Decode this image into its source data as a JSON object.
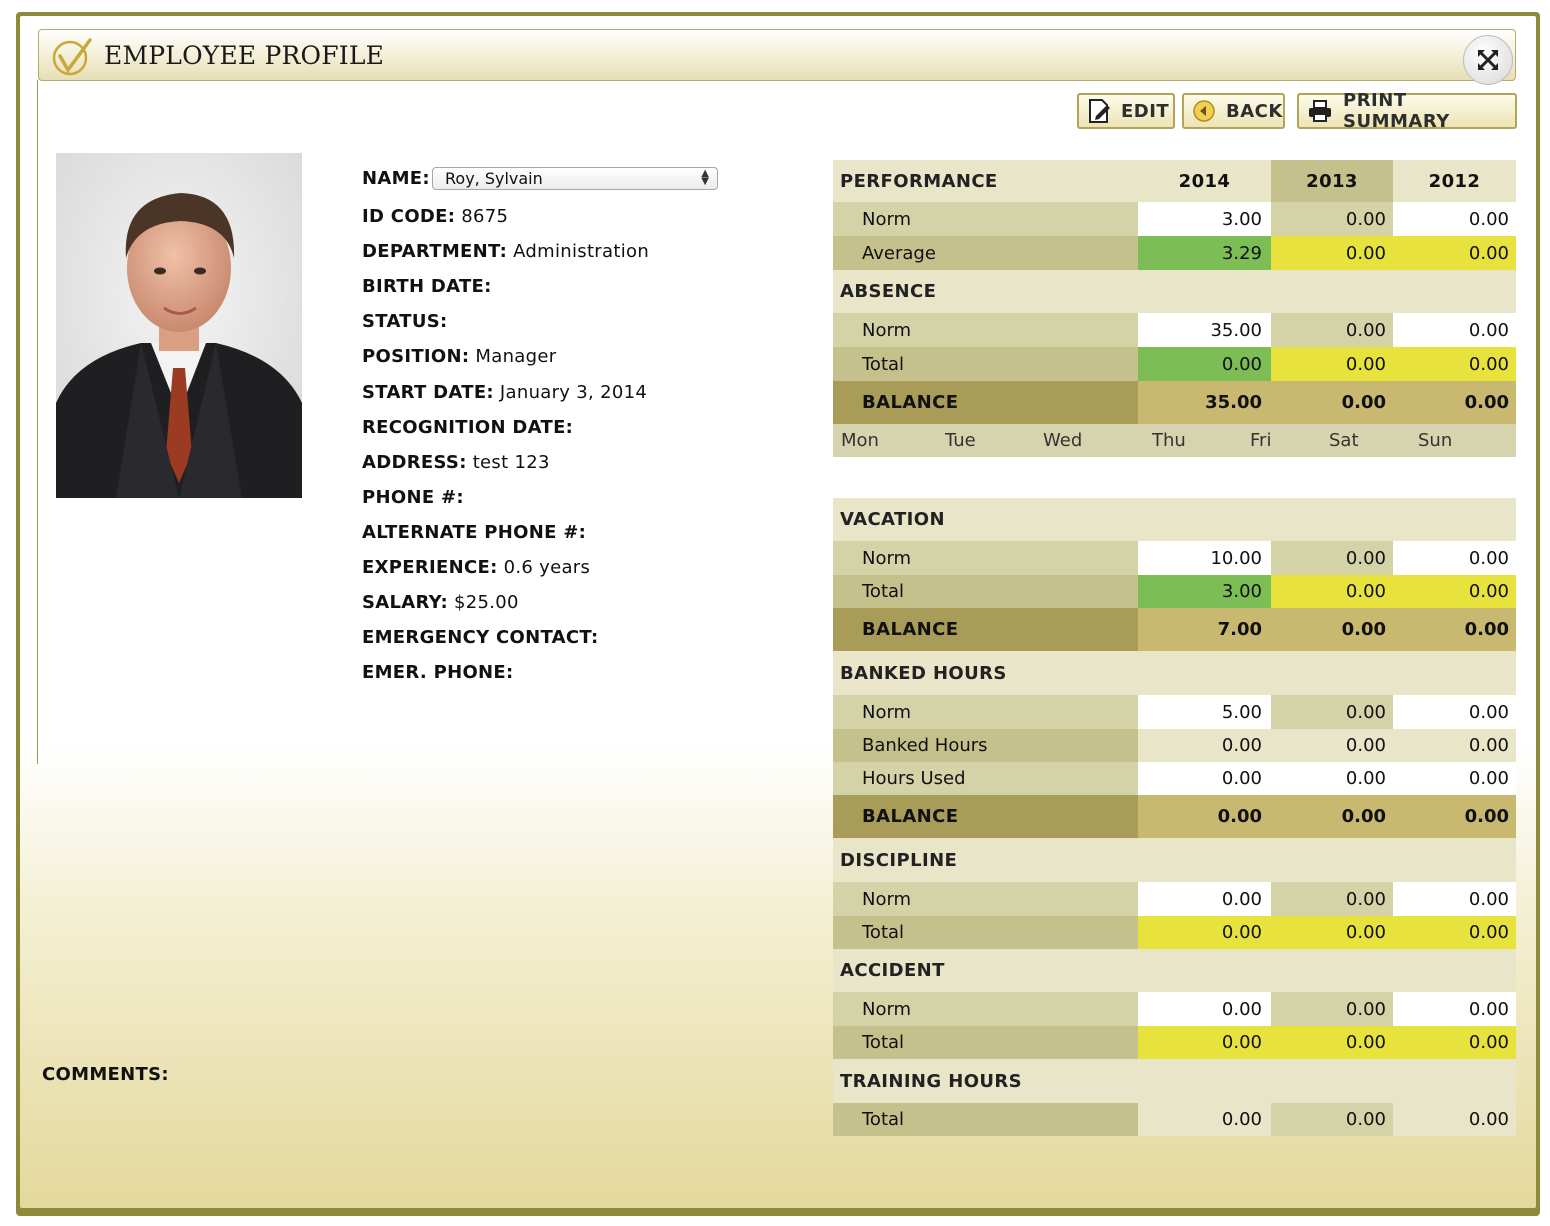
{
  "window": {
    "title": "EMPLOYEE PROFILE"
  },
  "toolbar": {
    "edit_label": "EDIT",
    "back_label": "BACK",
    "print_label": "PRINT SUMMARY"
  },
  "profile": {
    "name_label": "NAME:",
    "name_value": "Roy, Sylvain",
    "fields": [
      {
        "label": "ID CODE:",
        "value": "8675"
      },
      {
        "label": "DEPARTMENT:",
        "value": "Administration"
      },
      {
        "label": "BIRTH DATE:",
        "value": ""
      },
      {
        "label": "STATUS:",
        "value": ""
      },
      {
        "label": "POSITION:",
        "value": "Manager"
      },
      {
        "label": "START DATE:",
        "value": "January 3, 2014"
      },
      {
        "label": "RECOGNITION DATE:",
        "value": ""
      },
      {
        "label": "ADDRESS:",
        "value": "test 123"
      },
      {
        "label": "PHONE #:",
        "value": ""
      },
      {
        "label": "ALTERNATE PHONE #:",
        "value": ""
      },
      {
        "label": "EXPERIENCE:",
        "value": "0.6 years"
      },
      {
        "label": "SALARY:",
        "value": "$25.00"
      },
      {
        "label": "EMERGENCY CONTACT:",
        "value": ""
      },
      {
        "label": "EMER. PHONE:",
        "value": ""
      }
    ],
    "comments_label": "COMMENTS:"
  },
  "stats": {
    "years": [
      "2014",
      "2013",
      "2012"
    ],
    "performance": {
      "title": "PERFORMANCE",
      "norm_label": "Norm",
      "norm": [
        "3.00",
        "0.00",
        "0.00"
      ],
      "average_label": "Average",
      "average": [
        "3.29",
        "0.00",
        "0.00"
      ]
    },
    "absence": {
      "title": "ABSENCE",
      "norm_label": "Norm",
      "norm": [
        "35.00",
        "0.00",
        "0.00"
      ],
      "total_label": "Total",
      "total": [
        "0.00",
        "0.00",
        "0.00"
      ],
      "balance_label": "BALANCE",
      "balance": [
        "35.00",
        "0.00",
        "0.00"
      ]
    },
    "days": [
      "Mon",
      "Tue",
      "Wed",
      "Thu",
      "Fri",
      "Sat",
      "Sun"
    ],
    "vacation": {
      "title": "VACATION",
      "norm_label": "Norm",
      "norm": [
        "10.00",
        "0.00",
        "0.00"
      ],
      "total_label": "Total",
      "total": [
        "3.00",
        "0.00",
        "0.00"
      ],
      "balance_label": "BALANCE",
      "balance": [
        "7.00",
        "0.00",
        "0.00"
      ]
    },
    "banked": {
      "title": "BANKED HOURS",
      "norm_label": "Norm",
      "norm": [
        "5.00",
        "0.00",
        "0.00"
      ],
      "banked_label": "Banked Hours",
      "banked": [
        "0.00",
        "0.00",
        "0.00"
      ],
      "used_label": "Hours Used",
      "used": [
        "0.00",
        "0.00",
        "0.00"
      ],
      "balance_label": "BALANCE",
      "balance": [
        "0.00",
        "0.00",
        "0.00"
      ]
    },
    "discipline": {
      "title": "DISCIPLINE",
      "norm_label": "Norm",
      "norm": [
        "0.00",
        "0.00",
        "0.00"
      ],
      "total_label": "Total",
      "total": [
        "0.00",
        "0.00",
        "0.00"
      ]
    },
    "accident": {
      "title": "ACCIDENT",
      "norm_label": "Norm",
      "norm": [
        "0.00",
        "0.00",
        "0.00"
      ],
      "total_label": "Total",
      "total": [
        "0.00",
        "0.00",
        "0.00"
      ]
    },
    "training": {
      "title": "TRAINING HOURS",
      "total_label": "Total",
      "total": [
        "0.00",
        "0.00",
        "0.00"
      ]
    }
  },
  "colors": {
    "frame": "#8f8a3a",
    "green": "#7dbd56",
    "yellow": "#e7e23c",
    "label_bg": "#d4d3a7",
    "label_bg_dark": "#c5c18c",
    "balance_bg": "#c8b870",
    "balance_label_bg": "#a89c58"
  }
}
